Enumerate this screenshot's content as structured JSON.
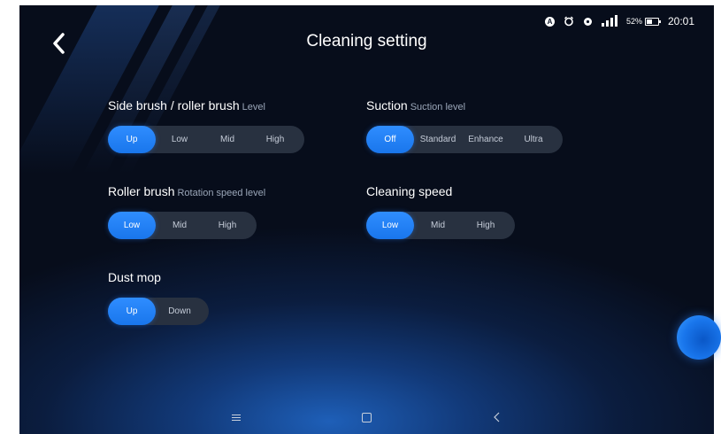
{
  "header": {
    "title": "Cleaning setting",
    "back_icon": "chevron-left-icon"
  },
  "status_bar": {
    "icons": [
      "a-circle-icon",
      "alarm-icon",
      "location-icon",
      "signal-icon",
      "battery-icon"
    ],
    "a_glyph": "A",
    "battery": "52%",
    "time": "20:01"
  },
  "sections": {
    "side_brush": {
      "label": "Side brush / roller brush",
      "sublabel": "Level",
      "options": [
        "Up",
        "Low",
        "Mid",
        "High"
      ],
      "selected": "Up"
    },
    "suction": {
      "label": "Suction",
      "sublabel": "Suction level",
      "options": [
        "Off",
        "Standard",
        "Enhance",
        "Ultra"
      ],
      "selected": "Off"
    },
    "roller_brush": {
      "label": "Roller brush",
      "sublabel": "Rotation speed level",
      "options": [
        "Low",
        "Mid",
        "High"
      ],
      "selected": "Low"
    },
    "cleaning_speed": {
      "label": "Cleaning speed",
      "options": [
        "Low",
        "Mid",
        "High"
      ],
      "selected": "Low"
    },
    "dust_mop": {
      "label": "Dust mop",
      "options": [
        "Up",
        "Down"
      ],
      "selected": "Up"
    }
  },
  "nav_bar": {
    "icons": [
      "menu-icon",
      "home-icon",
      "back-icon"
    ]
  },
  "colors": {
    "accent": "#1e82f5",
    "background": "#070d1b",
    "segment_bg": "#283140"
  }
}
